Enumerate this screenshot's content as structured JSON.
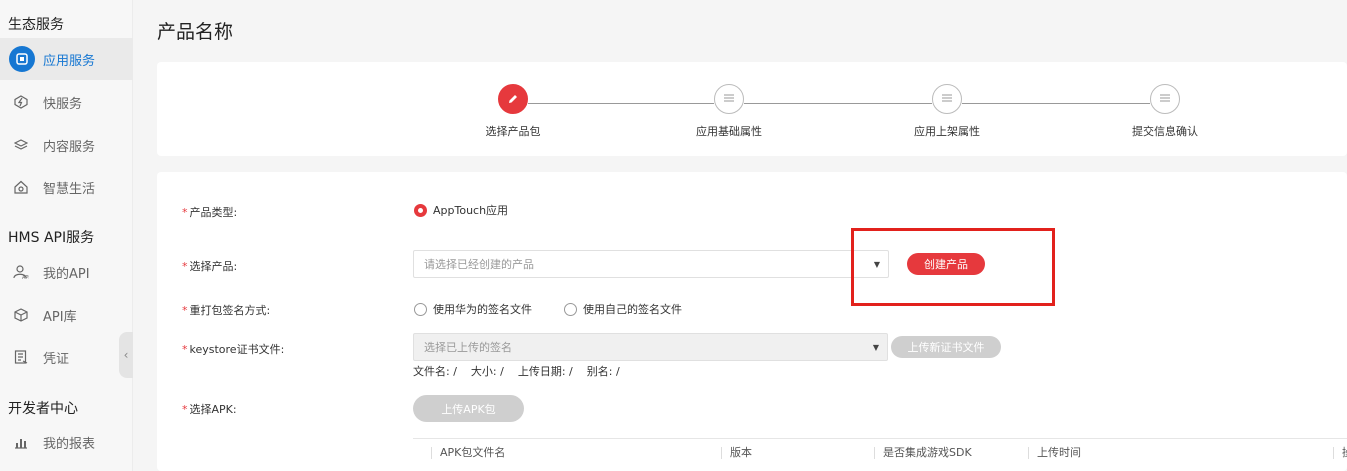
{
  "sidebar": {
    "groups": [
      {
        "title": "生态服务"
      },
      {
        "title": "HMS API服务"
      },
      {
        "title": "开发者中心"
      }
    ],
    "items": [
      {
        "label": "应用服务",
        "icon": "app-service-icon"
      },
      {
        "label": "快服务",
        "icon": "quick-service-icon"
      },
      {
        "label": "内容服务",
        "icon": "content-service-icon"
      },
      {
        "label": "智慧生活",
        "icon": "smart-life-icon"
      },
      {
        "label": "我的API",
        "icon": "my-api-icon"
      },
      {
        "label": "API库",
        "icon": "api-library-icon"
      },
      {
        "label": "凭证",
        "icon": "credential-icon"
      },
      {
        "label": "我的报表",
        "icon": "report-icon"
      }
    ],
    "collapse_glyph": "‹"
  },
  "page": {
    "title": "产品名称"
  },
  "steps": [
    {
      "label": "选择产品包",
      "active": true
    },
    {
      "label": "应用基础属性",
      "active": false
    },
    {
      "label": "应用上架属性",
      "active": false
    },
    {
      "label": "提交信息确认",
      "active": false
    }
  ],
  "form": {
    "required_mark": "*",
    "product_type": {
      "label": "产品类型:",
      "option": "AppTouch应用"
    },
    "select_product": {
      "label": "选择产品:",
      "placeholder": "请选择已经创建的产品",
      "create_button": "创建产品"
    },
    "resign": {
      "label": "重打包签名方式:",
      "option_1": "使用华为的签名文件",
      "option_2": "使用自己的签名文件"
    },
    "keystore": {
      "label": "keystore证书文件:",
      "placeholder": "选择已上传的签名",
      "upload_button": "上传新证书文件",
      "file_name": "文件名: /",
      "size": "大小: /",
      "upload_date": "上传日期: /",
      "alias": "别名: /"
    },
    "apk": {
      "label": "选择APK:",
      "upload_button": "上传APK包"
    }
  },
  "table": {
    "columns": [
      "APK包文件名",
      "版本",
      "是否集成游戏SDK",
      "上传时间",
      "操"
    ]
  },
  "colors": {
    "accent": "#e6393d",
    "brand_blue": "#1677d2",
    "highlight": "#e2211c"
  }
}
